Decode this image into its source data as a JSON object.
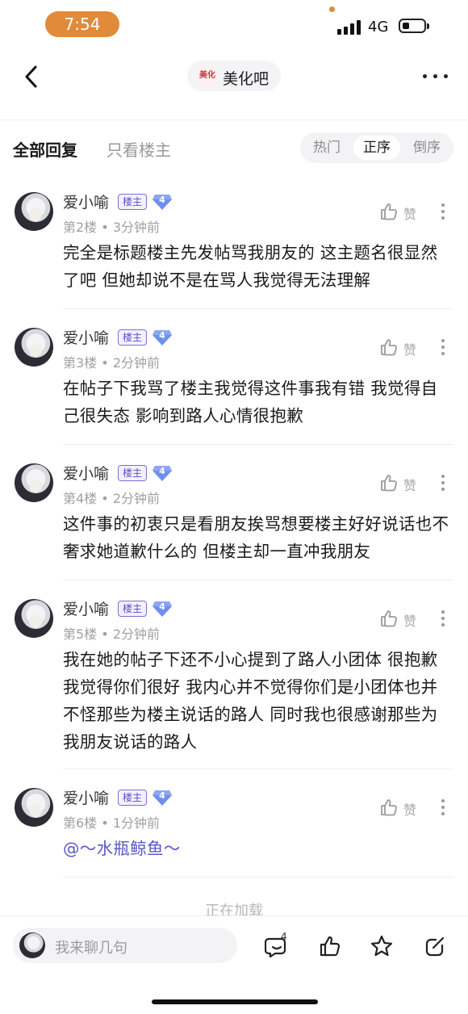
{
  "status_bar": {
    "time": "7:54",
    "network": "4G"
  },
  "nav": {
    "forum_name": "美化吧",
    "forum_logo_text": "美化"
  },
  "tabs": {
    "all": "全部回复",
    "op_only": "只看楼主"
  },
  "sort": {
    "hot": "热门",
    "asc": "正序",
    "desc": "倒序"
  },
  "posts": [
    {
      "user": "爱小喻",
      "badge": "楼主",
      "level": "4",
      "floor": "第2楼",
      "time": "3分钟前",
      "like": "赞",
      "text": "完全是标题楼主先发帖骂我朋友的 这主题名很显然了吧 但她却说不是在骂人我觉得无法理解"
    },
    {
      "user": "爱小喻",
      "badge": "楼主",
      "level": "4",
      "floor": "第3楼",
      "time": "2分钟前",
      "like": "赞",
      "text": "在帖子下我骂了楼主我觉得这件事我有错 我觉得自己很失态 影响到路人心情很抱歉"
    },
    {
      "user": "爱小喻",
      "badge": "楼主",
      "level": "4",
      "floor": "第4楼",
      "time": "2分钟前",
      "like": "赞",
      "text": "这件事的初衷只是看朋友挨骂想要楼主好好说话也不奢求她道歉什么的 但楼主却一直冲我朋友"
    },
    {
      "user": "爱小喻",
      "badge": "楼主",
      "level": "4",
      "floor": "第5楼",
      "time": "2分钟前",
      "like": "赞",
      "text": "我在她的帖子下还不小心提到了路人小团体 很抱歉 我觉得你们很好 我内心并不觉得你们是小团体也并不怪那些为楼主说话的路人 同时我也很感谢那些为我朋友说话的路人"
    },
    {
      "user": "爱小喻",
      "badge": "楼主",
      "level": "4",
      "floor": "第6楼",
      "time": "1分钟前",
      "like": "赞",
      "text": "@～水瓶鲸鱼～"
    }
  ],
  "meta_separator": "•",
  "loading": "正在加载",
  "bottom_bar": {
    "placeholder": "我来聊几句",
    "comment_count": "4"
  }
}
